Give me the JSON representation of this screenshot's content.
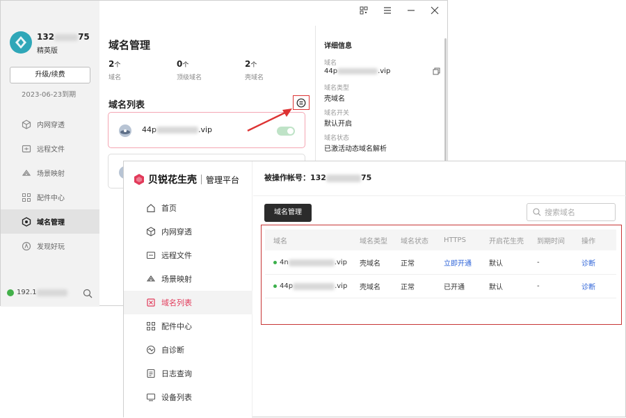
{
  "client": {
    "user": {
      "phone_prefix": "132",
      "phone_suffix": "75",
      "edition": "精英版"
    },
    "upgrade_label": "升级/续费",
    "expire": "2023-06-23到期",
    "nav": [
      {
        "label": "内网穿透",
        "icon": "globe-icon"
      },
      {
        "label": "远程文件",
        "icon": "folder-icon"
      },
      {
        "label": "场景映射",
        "icon": "cloud-icon"
      },
      {
        "label": "配件中心",
        "icon": "grid-icon"
      },
      {
        "label": "域名管理",
        "icon": "domain-icon"
      },
      {
        "label": "发现好玩",
        "icon": "discover-icon"
      }
    ],
    "ip_prefix": "192.1",
    "page_title": "域名管理",
    "stats": [
      {
        "value": "2",
        "unit": "个",
        "label": "域名"
      },
      {
        "value": "0",
        "unit": "个",
        "label": "顶级域名"
      },
      {
        "value": "2",
        "unit": "个",
        "label": "壳域名"
      }
    ],
    "list_title": "域名列表",
    "domain_item": {
      "prefix": "44p",
      "suffix": ".vip",
      "enabled": true
    },
    "detail": {
      "title": "详细信息",
      "fields": [
        {
          "label": "域名",
          "prefix": "44p",
          "suffix": ".vip"
        },
        {
          "label": "域名类型",
          "value": "壳域名"
        },
        {
          "label": "域名开关",
          "value": "默认开启"
        },
        {
          "label": "域名状态",
          "value": "已激活动态域名解析"
        }
      ]
    }
  },
  "web": {
    "brand": {
      "name": "贝锐花生壳",
      "sub": "管理平台"
    },
    "nav": [
      {
        "label": "首页",
        "icon": "home-icon"
      },
      {
        "label": "内网穿透",
        "icon": "cube-icon"
      },
      {
        "label": "远程文件",
        "icon": "folder-icon"
      },
      {
        "label": "场景映射",
        "icon": "cloud-icon"
      },
      {
        "label": "域名列表",
        "icon": "domain-list-icon",
        "active": true
      },
      {
        "label": "配件中心",
        "icon": "grid-icon"
      },
      {
        "label": "自诊断",
        "icon": "diagnose-icon"
      },
      {
        "label": "日志查询",
        "icon": "log-icon"
      },
      {
        "label": "设备列表",
        "icon": "device-icon"
      }
    ],
    "account_label": "被操作帐号：",
    "account_prefix": "132",
    "account_suffix": "75",
    "tab_button": "域名管理",
    "search_placeholder": "搜索域名",
    "table": {
      "headers": [
        "域名",
        "域名类型",
        "域名状态",
        "HTTPS",
        "开启花生壳",
        "到期时间",
        "操作"
      ],
      "rows": [
        {
          "prefix": "4n",
          "suffix": ".vip",
          "type": "壳域名",
          "status": "正常",
          "https": "立即开通",
          "enabled": "默认",
          "expire": "-",
          "action": "诊断"
        },
        {
          "prefix": "44p",
          "suffix": ".vip",
          "type": "壳域名",
          "status": "正常",
          "https": "已开通",
          "enabled": "默认",
          "expire": "-",
          "action": "诊断"
        }
      ]
    }
  },
  "colors": {
    "accent": "#e23a5a",
    "link": "#2d63d8",
    "annotation": "#d33333",
    "status_ok": "#3bb04b"
  }
}
